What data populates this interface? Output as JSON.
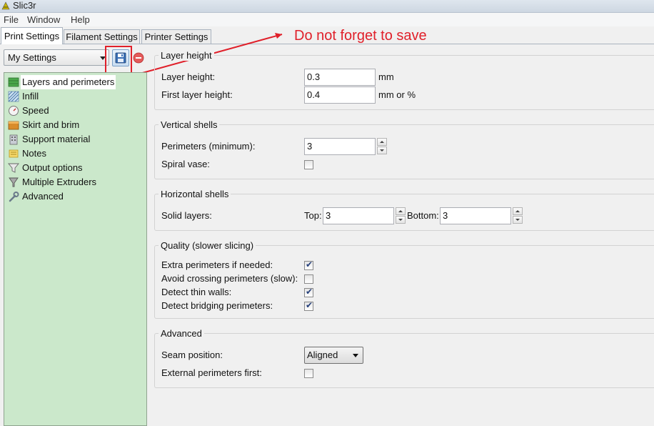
{
  "window": {
    "title": "Slic3r"
  },
  "menu": [
    "File",
    "Window",
    "Help"
  ],
  "tabs": [
    "Print Settings",
    "Filament Settings",
    "Printer Settings"
  ],
  "preset": {
    "selected": "My Settings"
  },
  "annotation": {
    "text": "Do not forget to save",
    "color": "#e0202a"
  },
  "pages": [
    "Layers and perimeters",
    "Infill",
    "Speed",
    "Skirt and brim",
    "Support material",
    "Notes",
    "Output options",
    "Multiple Extruders",
    "Advanced"
  ],
  "groups": {
    "layer_height": {
      "title": "Layer height",
      "layer_height": {
        "label": "Layer height:",
        "value": "0.3",
        "unit": "mm"
      },
      "first_layer_height": {
        "label": "First layer height:",
        "value": "0.4",
        "unit": "mm or %"
      }
    },
    "vertical_shells": {
      "title": "Vertical shells",
      "perimeters": {
        "label": "Perimeters (minimum):",
        "value": "3"
      },
      "spiral_vase": {
        "label": "Spiral vase:",
        "checked": false
      }
    },
    "horizontal_shells": {
      "title": "Horizontal shells",
      "solid_layers": {
        "label": "Solid layers:",
        "top_label": "Top:",
        "top_value": "3",
        "bottom_label": "Bottom:",
        "bottom_value": "3"
      }
    },
    "quality": {
      "title": "Quality (slower slicing)",
      "extra_perimeters": {
        "label": "Extra perimeters if needed:",
        "checked": true
      },
      "avoid_crossing": {
        "label": "Avoid crossing perimeters (slow):",
        "checked": false
      },
      "thin_walls": {
        "label": "Detect thin walls:",
        "checked": true
      },
      "bridging": {
        "label": "Detect bridging perimeters:",
        "checked": true
      }
    },
    "advanced": {
      "title": "Advanced",
      "seam_position": {
        "label": "Seam position:",
        "value": "Aligned"
      },
      "external_first": {
        "label": "External perimeters first:",
        "checked": false
      }
    }
  },
  "colors": {
    "sidebar": "#cbe8cb",
    "accent": "#e0202a"
  }
}
